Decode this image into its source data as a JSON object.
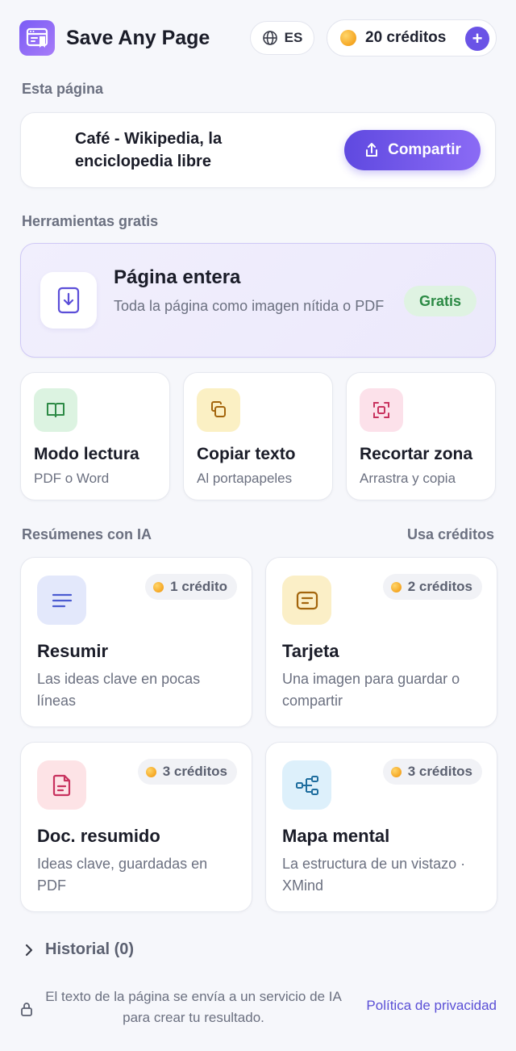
{
  "header": {
    "title": "Save Any Page",
    "language": "ES",
    "credits": "20 créditos",
    "add_label": "+"
  },
  "sections": {
    "this_page": "Esta página",
    "free_tools": "Herramientas gratis",
    "ai_summaries": "Resúmenes con IA",
    "ai_note": "Usa créditos"
  },
  "page": {
    "title": "Café - Wikipedia, la enciclopedia libre",
    "share_label": "Compartir"
  },
  "full_page": {
    "title": "Página entera",
    "description": "Toda la página como imagen nítida o PDF",
    "badge": "Gratis"
  },
  "tools": [
    {
      "title": "Modo lectura",
      "subtitle": "PDF o Word",
      "icon": "book-icon"
    },
    {
      "title": "Copiar texto",
      "subtitle": "Al portapapeles",
      "icon": "copy-icon"
    },
    {
      "title": "Recortar zona",
      "subtitle": "Arrastra y copia",
      "icon": "crop-icon"
    }
  ],
  "ai": [
    {
      "title": "Resumir",
      "description": "Las ideas clave en pocas líneas",
      "cost": "1 crédito",
      "icon": "lines-icon"
    },
    {
      "title": "Tarjeta",
      "description": "Una imagen para guardar o compartir",
      "cost": "2 créditos",
      "icon": "card-icon"
    },
    {
      "title": "Doc. resumido",
      "description": "Ideas clave, guardadas en PDF",
      "cost": "3 créditos",
      "icon": "document-icon"
    },
    {
      "title": "Mapa mental",
      "description": "La estructura de un vistazo · XMind",
      "cost": "3 créditos",
      "icon": "mindmap-icon"
    }
  ],
  "history": {
    "label": "Historial (0)"
  },
  "footer": {
    "notice": "El texto de la página se envía a un servicio de IA para crear tu resultado.",
    "privacy": "Política de privacidad"
  },
  "colors": {
    "accent": "#6a53e6",
    "free_green": "#2c8a45",
    "coin": "#f5a623"
  }
}
